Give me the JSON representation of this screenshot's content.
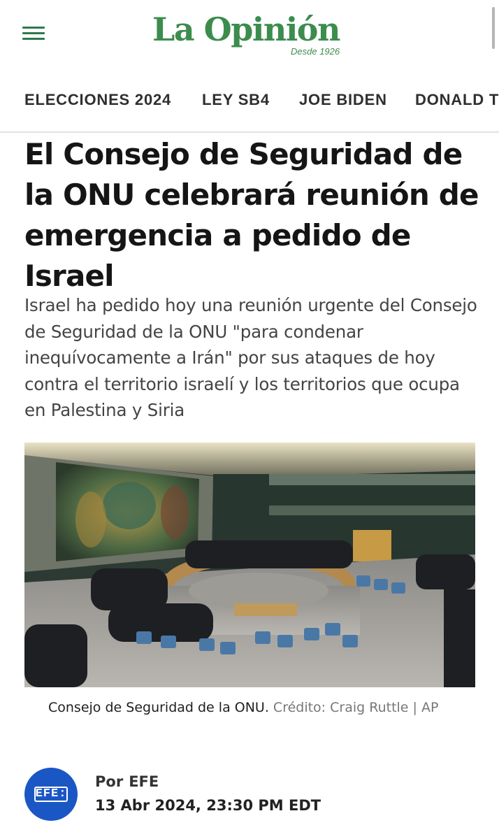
{
  "site": {
    "logo_text": "La Opinión",
    "tagline": "Desde 1926"
  },
  "nav": {
    "items": [
      "ELECCIONES 2024",
      "LEY SB4",
      "JOE BIDEN",
      "DONALD T"
    ]
  },
  "article": {
    "headline": "El Consejo de Seguridad de la ONU celebrará reunión de emergencia a pedido de Israel",
    "summary": "Israel ha pedido hoy una reunión urgente del Consejo de Seguridad de la ONU \"para condenar inequívocamente a Irán\" por sus ataques de hoy contra el territorio israelí y los territorios que ocupa en Palestina y Siria",
    "image": {
      "caption": "Consejo de Seguridad de la ONU.",
      "credit": "Crédito: Craig Ruttle | AP"
    },
    "byline": {
      "prefix": "Por",
      "author": "EFE",
      "author_logo_text": "EFE:",
      "date": "13 Abr 2024, 23:30 PM EDT"
    }
  },
  "colors": {
    "brand_green": "#3c8c4e",
    "menu_green": "#2c7a4b",
    "efe_blue": "#1b57c4"
  },
  "icons": {
    "menu": "hamburger-menu-icon"
  }
}
